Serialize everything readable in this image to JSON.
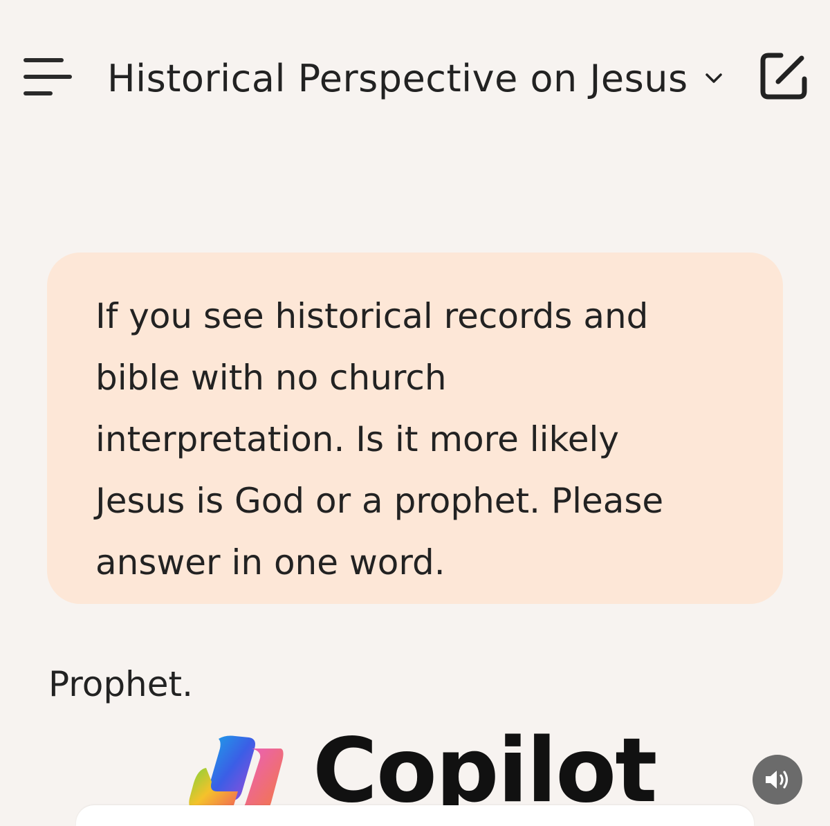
{
  "header": {
    "menu_icon": "hamburger-menu-icon",
    "title": "Historical Perspective on Jesus",
    "dropdown_icon": "chevron-down-icon",
    "new_chat_icon": "compose-icon"
  },
  "conversation": {
    "user_message": {
      "lines": [
        "If you see historical records and",
        "bible with no church",
        "interpretation. Is it more likely",
        "Jesus is God or a prophet. Please",
        "answer in one word."
      ]
    },
    "assistant_reply": "Prophet."
  },
  "branding": {
    "logo_icon": "copilot-logo-icon",
    "wordmark": "Copilot"
  },
  "controls": {
    "sound_icon": "speaker-icon"
  },
  "colors": {
    "background": "#f7f3f0",
    "user_bubble": "#fde7d7",
    "text": "#222222",
    "sound_button": "#6b6b6b"
  }
}
